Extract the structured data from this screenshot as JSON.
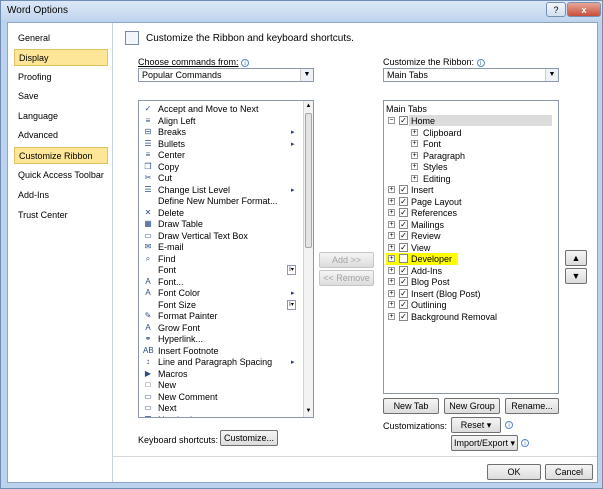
{
  "window": {
    "title": "Word Options",
    "help_label": "?",
    "close_label": "x"
  },
  "nav": [
    {
      "label": "General"
    },
    {
      "label": "Display"
    },
    {
      "label": "Proofing"
    },
    {
      "label": "Save"
    },
    {
      "label": "Language"
    },
    {
      "label": "Advanced"
    },
    {
      "label": "Customize Ribbon"
    },
    {
      "label": "Quick Access Toolbar"
    },
    {
      "label": "Add-Ins"
    },
    {
      "label": "Trust Center"
    }
  ],
  "header": {
    "text": "Customize the Ribbon and keyboard shortcuts."
  },
  "left": {
    "choose_label": "Choose commands from:",
    "choose_value": "Popular Commands",
    "commands": [
      {
        "label": "Accept and Move to Next",
        "icon": "✓"
      },
      {
        "label": "Align Left",
        "icon": "≡"
      },
      {
        "label": "Breaks",
        "icon": "⊟",
        "sub": "▸"
      },
      {
        "label": "Bullets",
        "icon": "☰",
        "sub": "▸"
      },
      {
        "label": "Center",
        "icon": "≡"
      },
      {
        "label": "Copy",
        "icon": "❐"
      },
      {
        "label": "Cut",
        "icon": "✂"
      },
      {
        "label": "Change List Level",
        "icon": "☰",
        "sub": "▸"
      },
      {
        "label": "Define New Number Format...",
        "icon": ""
      },
      {
        "label": "Delete",
        "icon": "✕"
      },
      {
        "label": "Draw Table",
        "icon": "▦"
      },
      {
        "label": "Draw Vertical Text Box",
        "icon": "▭"
      },
      {
        "label": "E-mail",
        "icon": "✉"
      },
      {
        "label": "Find",
        "icon": "⌕"
      },
      {
        "label": "Font",
        "icon": "",
        "dd": "I▾"
      },
      {
        "label": "Font...",
        "icon": "A"
      },
      {
        "label": "Font Color",
        "icon": "A",
        "sub": "▸"
      },
      {
        "label": "Font Size",
        "icon": "",
        "dd": "I▾"
      },
      {
        "label": "Format Painter",
        "icon": "✎"
      },
      {
        "label": "Grow Font",
        "icon": "A"
      },
      {
        "label": "Hyperlink...",
        "icon": "⚭"
      },
      {
        "label": "Insert Footnote",
        "icon": "AB"
      },
      {
        "label": "Line and Paragraph Spacing",
        "icon": "↕",
        "sub": "▸"
      },
      {
        "label": "Macros",
        "icon": "▶"
      },
      {
        "label": "New",
        "icon": "□"
      },
      {
        "label": "New Comment",
        "icon": "▭"
      },
      {
        "label": "Next",
        "icon": "▭"
      },
      {
        "label": "Numbering",
        "icon": "☰"
      }
    ]
  },
  "middle": {
    "add_label": "Add >>",
    "remove_label": "<< Remove"
  },
  "right": {
    "customize_label": "Customize the Ribbon:",
    "customize_value": "Main Tabs",
    "tree_header": "Main Tabs",
    "tree": [
      {
        "label": "Home",
        "depth": 0,
        "exp": "−",
        "checked": true,
        "selected": true
      },
      {
        "label": "Clipboard",
        "depth": 1,
        "exp": "+"
      },
      {
        "label": "Font",
        "depth": 1,
        "exp": "+"
      },
      {
        "label": "Paragraph",
        "depth": 1,
        "exp": "+"
      },
      {
        "label": "Styles",
        "depth": 1,
        "exp": "+"
      },
      {
        "label": "Editing",
        "depth": 1,
        "exp": "+"
      },
      {
        "label": "Insert",
        "depth": 0,
        "exp": "+",
        "checked": true
      },
      {
        "label": "Page Layout",
        "depth": 0,
        "exp": "+",
        "checked": true
      },
      {
        "label": "References",
        "depth": 0,
        "exp": "+",
        "checked": true
      },
      {
        "label": "Mailings",
        "depth": 0,
        "exp": "+",
        "checked": true
      },
      {
        "label": "Review",
        "depth": 0,
        "exp": "+",
        "checked": true
      },
      {
        "label": "View",
        "depth": 0,
        "exp": "+",
        "checked": true
      },
      {
        "label": "Developer",
        "depth": 0,
        "exp": "+",
        "checked": false,
        "highlight": true
      },
      {
        "label": "Add-Ins",
        "depth": 0,
        "exp": "+",
        "checked": true
      },
      {
        "label": "Blog Post",
        "depth": 0,
        "exp": "+",
        "checked": true
      },
      {
        "label": "Insert (Blog Post)",
        "depth": 0,
        "exp": "+",
        "checked": true
      },
      {
        "label": "Outlining",
        "depth": 0,
        "exp": "+",
        "checked": true
      },
      {
        "label": "Background Removal",
        "depth": 0,
        "exp": "+",
        "checked": true
      }
    ],
    "new_tab_label": "New Tab",
    "new_group_label": "New Group",
    "rename_label": "Rename...",
    "customizations_label": "Customizations:",
    "reset_label": "Reset ▾",
    "import_export_label": "Import/Export ▾",
    "move_up_label": "▲",
    "move_down_label": "▼"
  },
  "footer": {
    "keyboard_label": "Keyboard shortcuts:",
    "customize_btn": "Customize...",
    "ok_label": "OK",
    "cancel_label": "Cancel"
  },
  "colors": {
    "highlight": "#ffff00",
    "selected_nav": "#fde698"
  }
}
